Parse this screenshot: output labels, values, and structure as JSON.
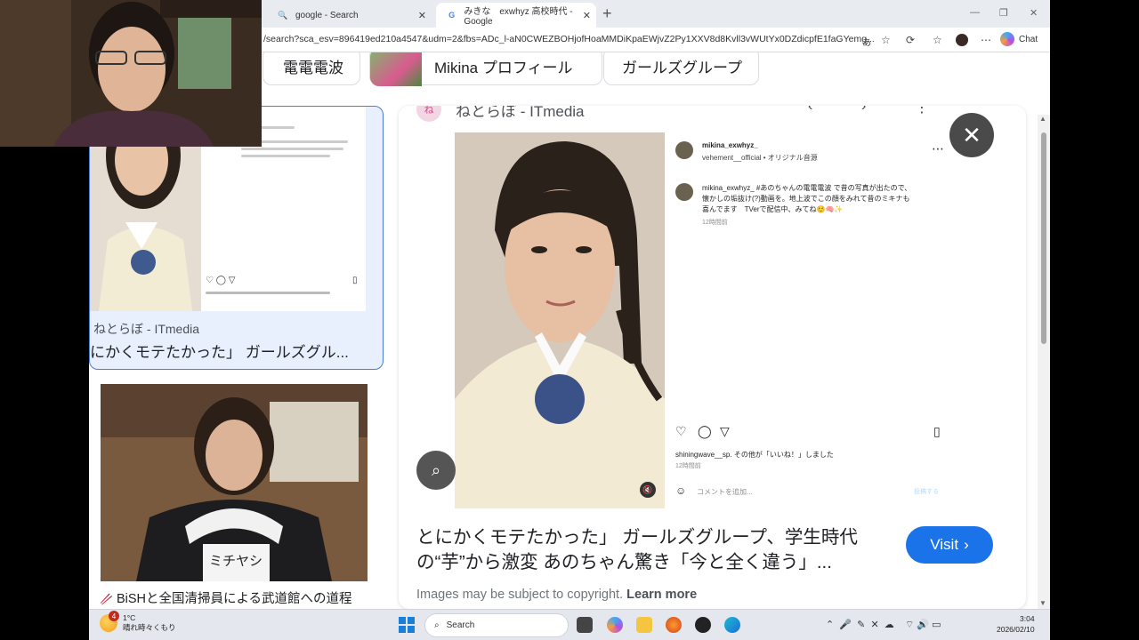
{
  "browser": {
    "tabs": [
      {
        "label": "google - Search",
        "icon": "search-icon"
      },
      {
        "label": "みきな　exwhyz 高校時代 - Google",
        "icon": "google-g-icon"
      }
    ],
    "url": "/search?sca_esv=896419ed210a4547&udm=2&fbs=ADc_l-aN0CWEZBOHjofHoaMMDiKpaEWjvZ2Py1XXV8d8Kvll3vWUtYx0DZdicpfE1faGYemg...",
    "chat_label": "Chat"
  },
  "chips": [
    "電電電波",
    "Mikina プロフィール",
    "ガールズグループ"
  ],
  "left_card": {
    "source": "ねとらぼ - ITmedia",
    "title": "にかくモテたかった」 ガールズグル..."
  },
  "left_card2": {
    "caption": "BiSHと全国清掃員による武道館への道程",
    "name_tag": "ミチヤシ"
  },
  "preview": {
    "source": "ねとらぼ - ITmedia",
    "title": "とにかくモテたかった」 ガールズグループ、学生時代の“芋”から激変 あのちゃん驚き「今と全く違う」...",
    "visit_label": "Visit",
    "copyright_text": "Images may be subject to copyright.",
    "learn_more": "Learn more",
    "instagram": {
      "user": "mikina_exwhyz_",
      "sub": "vehement__official • オリジナル音源",
      "caption": "mikina_exwhyz_ #あのちゃんの電電電波 で昔の写真が出たので、懐かしの垢抜け(?)動画を。地上波でこの顔をみれて昔のミキナも喜んでます　TVerで配信中、みてね☺️🧠✨",
      "time": "12時間前",
      "likes": "shiningwave__sp. その他が「いいね！」しました",
      "likes_time": "12時間前",
      "comment_placeholder": "コメントを追加...",
      "post_label": "投稿する"
    }
  },
  "taskbar": {
    "weather_temp": "1°C",
    "weather_desc": "晴れ時々くもり",
    "weather_badge": "4",
    "search_label": "Search",
    "time": "3:04",
    "date": "2026/02/10"
  }
}
